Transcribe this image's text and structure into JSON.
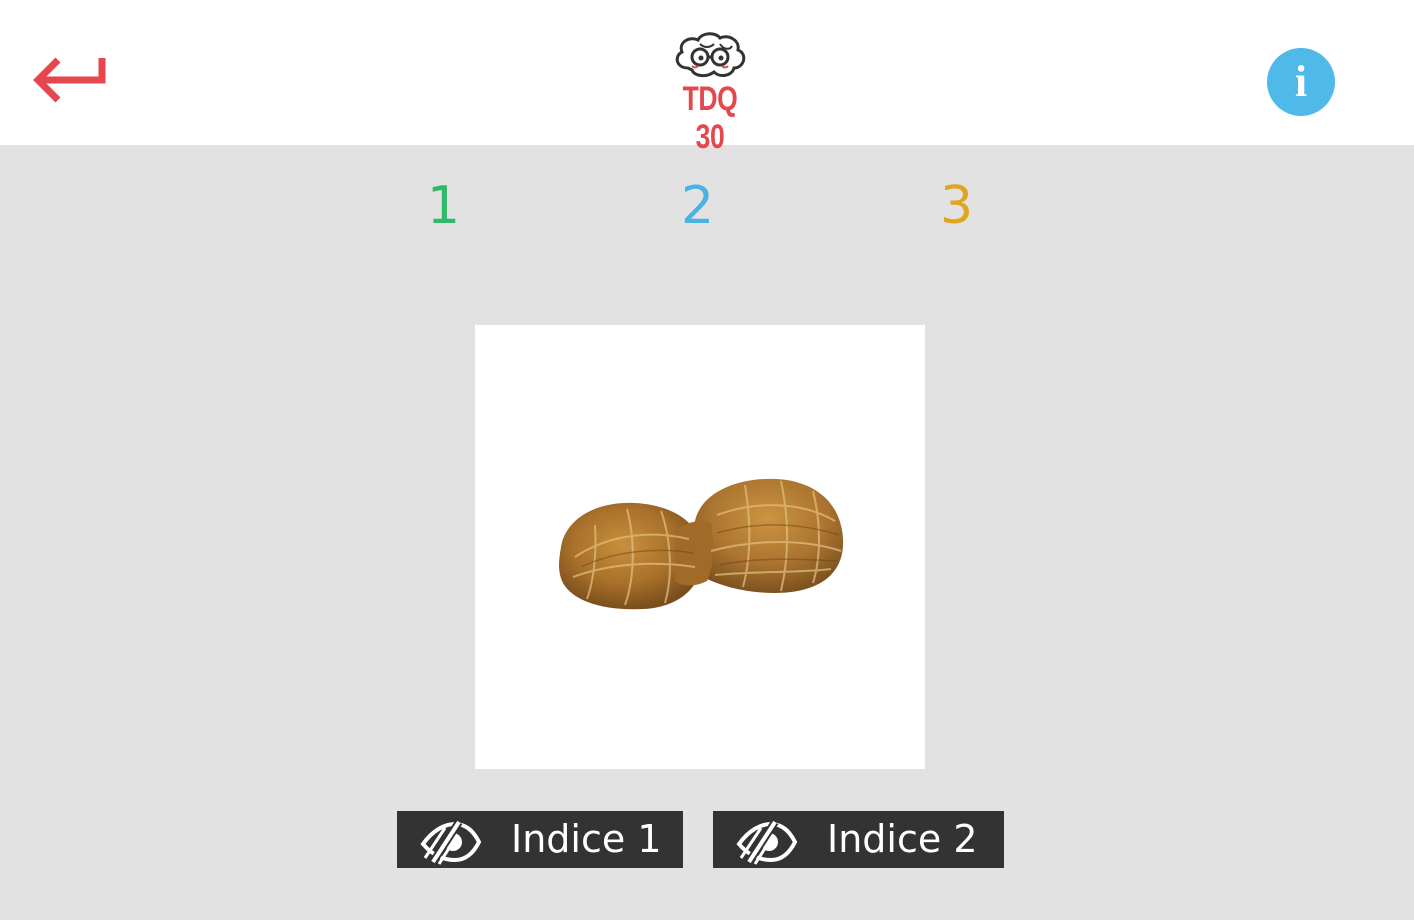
{
  "header": {
    "back_icon": "return-arrow-icon",
    "logo": {
      "icon": "brain-with-glasses-icon",
      "text": "TDQ 30"
    },
    "info_icon": "info-icon",
    "info_label": "i"
  },
  "steps": [
    {
      "label": "1",
      "color": "#2fb968"
    },
    {
      "label": "2",
      "color": "#4ab3e3"
    },
    {
      "label": "3",
      "color": "#e1a51d"
    }
  ],
  "main": {
    "image": {
      "subject": "peanut"
    }
  },
  "hints": [
    {
      "label": "Indice 1",
      "icon": "eye-slash-icon"
    },
    {
      "label": "Indice 2",
      "icon": "eye-slash-icon"
    }
  ],
  "colors": {
    "accent_red": "#e4474d",
    "info_blue": "#4fb9ea",
    "button_dark": "#333333",
    "background": "#e2e2e2"
  }
}
